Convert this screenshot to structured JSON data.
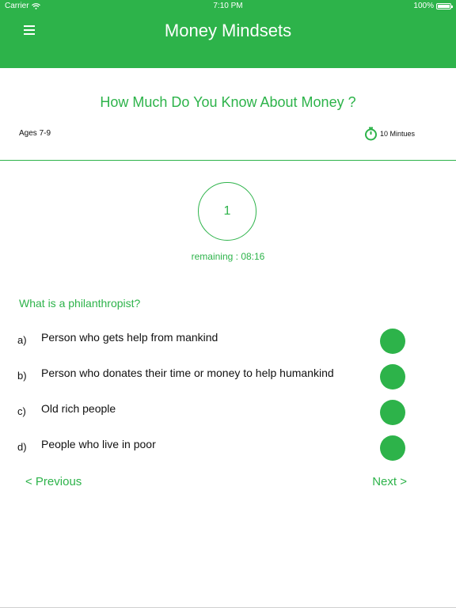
{
  "status_bar": {
    "carrier": "Carrier",
    "time": "7:10 PM",
    "battery": "100%"
  },
  "header": {
    "title": "Money Mindsets",
    "color": "#2db34a",
    "menu_icon": "hamburger-icon"
  },
  "quiz": {
    "title": "How Much Do You  Know About Money ?",
    "ages": "Ages 7-9",
    "duration": "10 Mintues",
    "duration_icon": "stopwatch-icon",
    "question_number": "1",
    "remaining_label": "remaining : 08:16"
  },
  "question": {
    "text": "What is a philanthropist?",
    "options": [
      {
        "letter": "a)",
        "text": "Person who gets help from mankind"
      },
      {
        "letter": "b)",
        "text": "Person who donates their time or money to help humankind"
      },
      {
        "letter": "c)",
        "text": "Old rich people"
      },
      {
        "letter": "d)",
        "text": "People who live in poor"
      }
    ]
  },
  "navigation": {
    "previous_label": "< Previous",
    "next_label": "Next >"
  }
}
